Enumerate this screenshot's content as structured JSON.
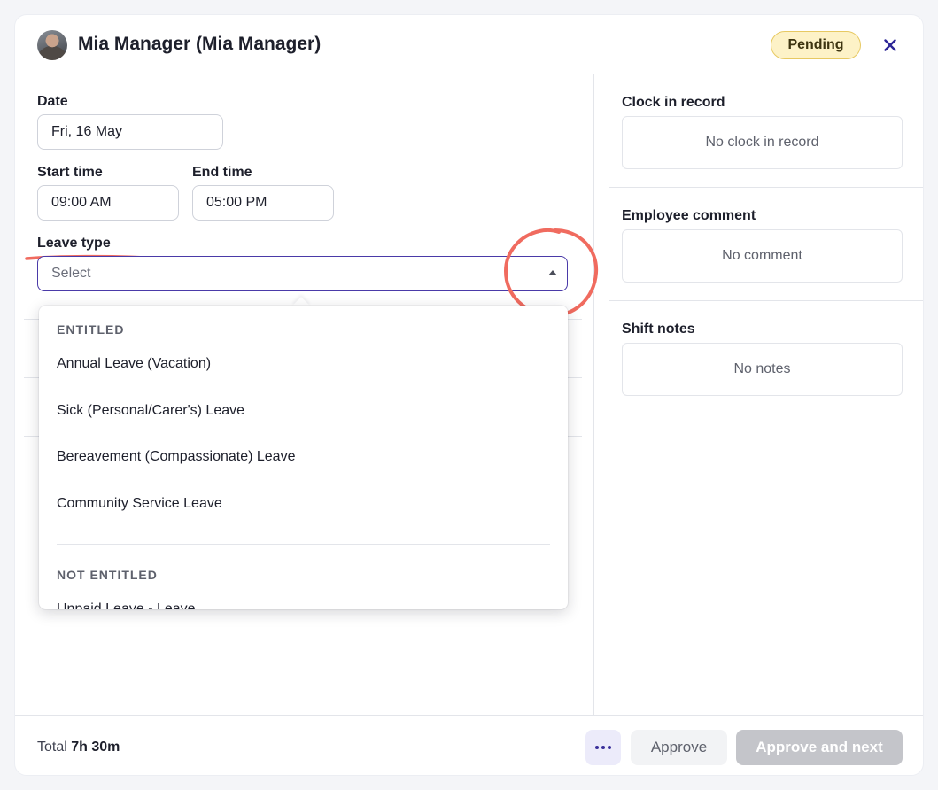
{
  "header": {
    "title": "Mia Manager (Mia Manager)",
    "status": "Pending",
    "avatar_icon": "user-avatar",
    "close_icon": "close-icon"
  },
  "form": {
    "date_label": "Date",
    "date_value": "Fri, 16 May",
    "start_label": "Start time",
    "start_value": "09:00 AM",
    "end_label": "End time",
    "end_value": "05:00 PM",
    "leave_label": "Leave type",
    "leave_placeholder": "Select"
  },
  "dropdown": {
    "entitled_label": "ENTITLED",
    "entitled": [
      "Annual Leave (Vacation)",
      "Sick (Personal/Carer's) Leave",
      "Bereavement (Compassionate) Leave",
      "Community Service Leave"
    ],
    "not_entitled_label": "NOT ENTITLED",
    "not_entitled": [
      "Unpaid Leave - Leave"
    ]
  },
  "side": {
    "clock_label": "Clock in record",
    "clock_value": "No clock in record",
    "comment_label": "Employee comment",
    "comment_value": "No comment",
    "notes_label": "Shift notes",
    "notes_value": "No notes"
  },
  "footer": {
    "total_prefix": "Total",
    "total_value": "7h 30m",
    "approve": "Approve",
    "approve_next": "Approve and next"
  },
  "colors": {
    "accent": "#4a3aa8",
    "annotation": "#f06b5f",
    "badge_bg": "#fdf2c7"
  }
}
